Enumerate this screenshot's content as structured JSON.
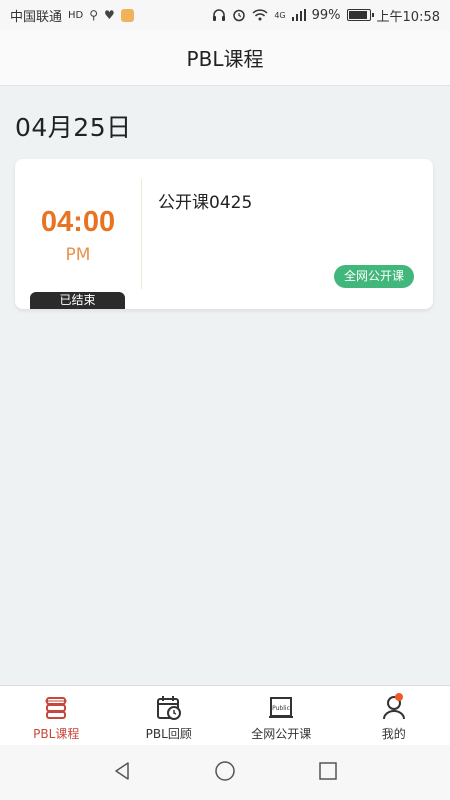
{
  "status_bar": {
    "carrier": "中国联通",
    "carrier_extra": "HD",
    "network_badge": "4G",
    "battery": "99%",
    "time": "上午10:58",
    "icons": [
      "usb-icon",
      "health-icon",
      "app-icon",
      "headphones-icon",
      "alarm-icon",
      "wifi-icon",
      "signal-icon",
      "battery-icon"
    ]
  },
  "header": {
    "title": "PBL课程"
  },
  "main": {
    "date": "04月25日",
    "courses": [
      {
        "time": "04:00",
        "ampm": "PM",
        "title": "公开课0425",
        "status": "已结束",
        "tag": "全网公开课"
      }
    ]
  },
  "tabbar": {
    "items": [
      {
        "label": "PBL课程",
        "icon": "books-icon",
        "active": true
      },
      {
        "label": "PBL回顾",
        "icon": "calendar-clock-icon",
        "active": false
      },
      {
        "label": "全网公开课",
        "icon": "public-board-icon",
        "active": false
      },
      {
        "label": "我的",
        "icon": "user-icon",
        "active": false,
        "badge": true
      }
    ]
  },
  "colors": {
    "accent_orange": "#e87320",
    "tag_green": "#42b77b",
    "active_tab": "#c8473b",
    "badge_dot": "#f05a28"
  }
}
